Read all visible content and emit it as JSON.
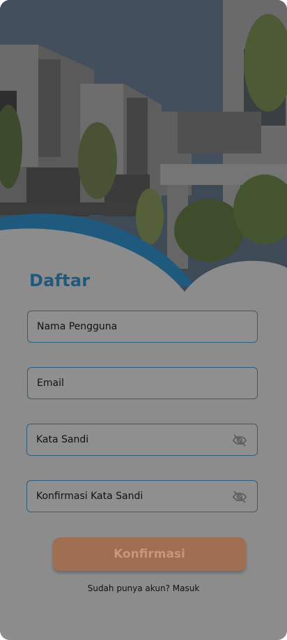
{
  "form": {
    "title": "Daftar",
    "fields": {
      "username": "Nama Pengguna",
      "email": "Email",
      "password": "Kata Sandi",
      "confirm_password": "Konfirmasi Kata Sandi"
    },
    "submit_label": "Konfirmasi",
    "login_prompt": "Sudah punya akun? Masuk"
  },
  "icons": {
    "password_toggle": "eye-off-icon"
  },
  "colors": {
    "accent": "#1f5a7e",
    "button": "#a06f52",
    "overlay": "#8c8c8c"
  }
}
